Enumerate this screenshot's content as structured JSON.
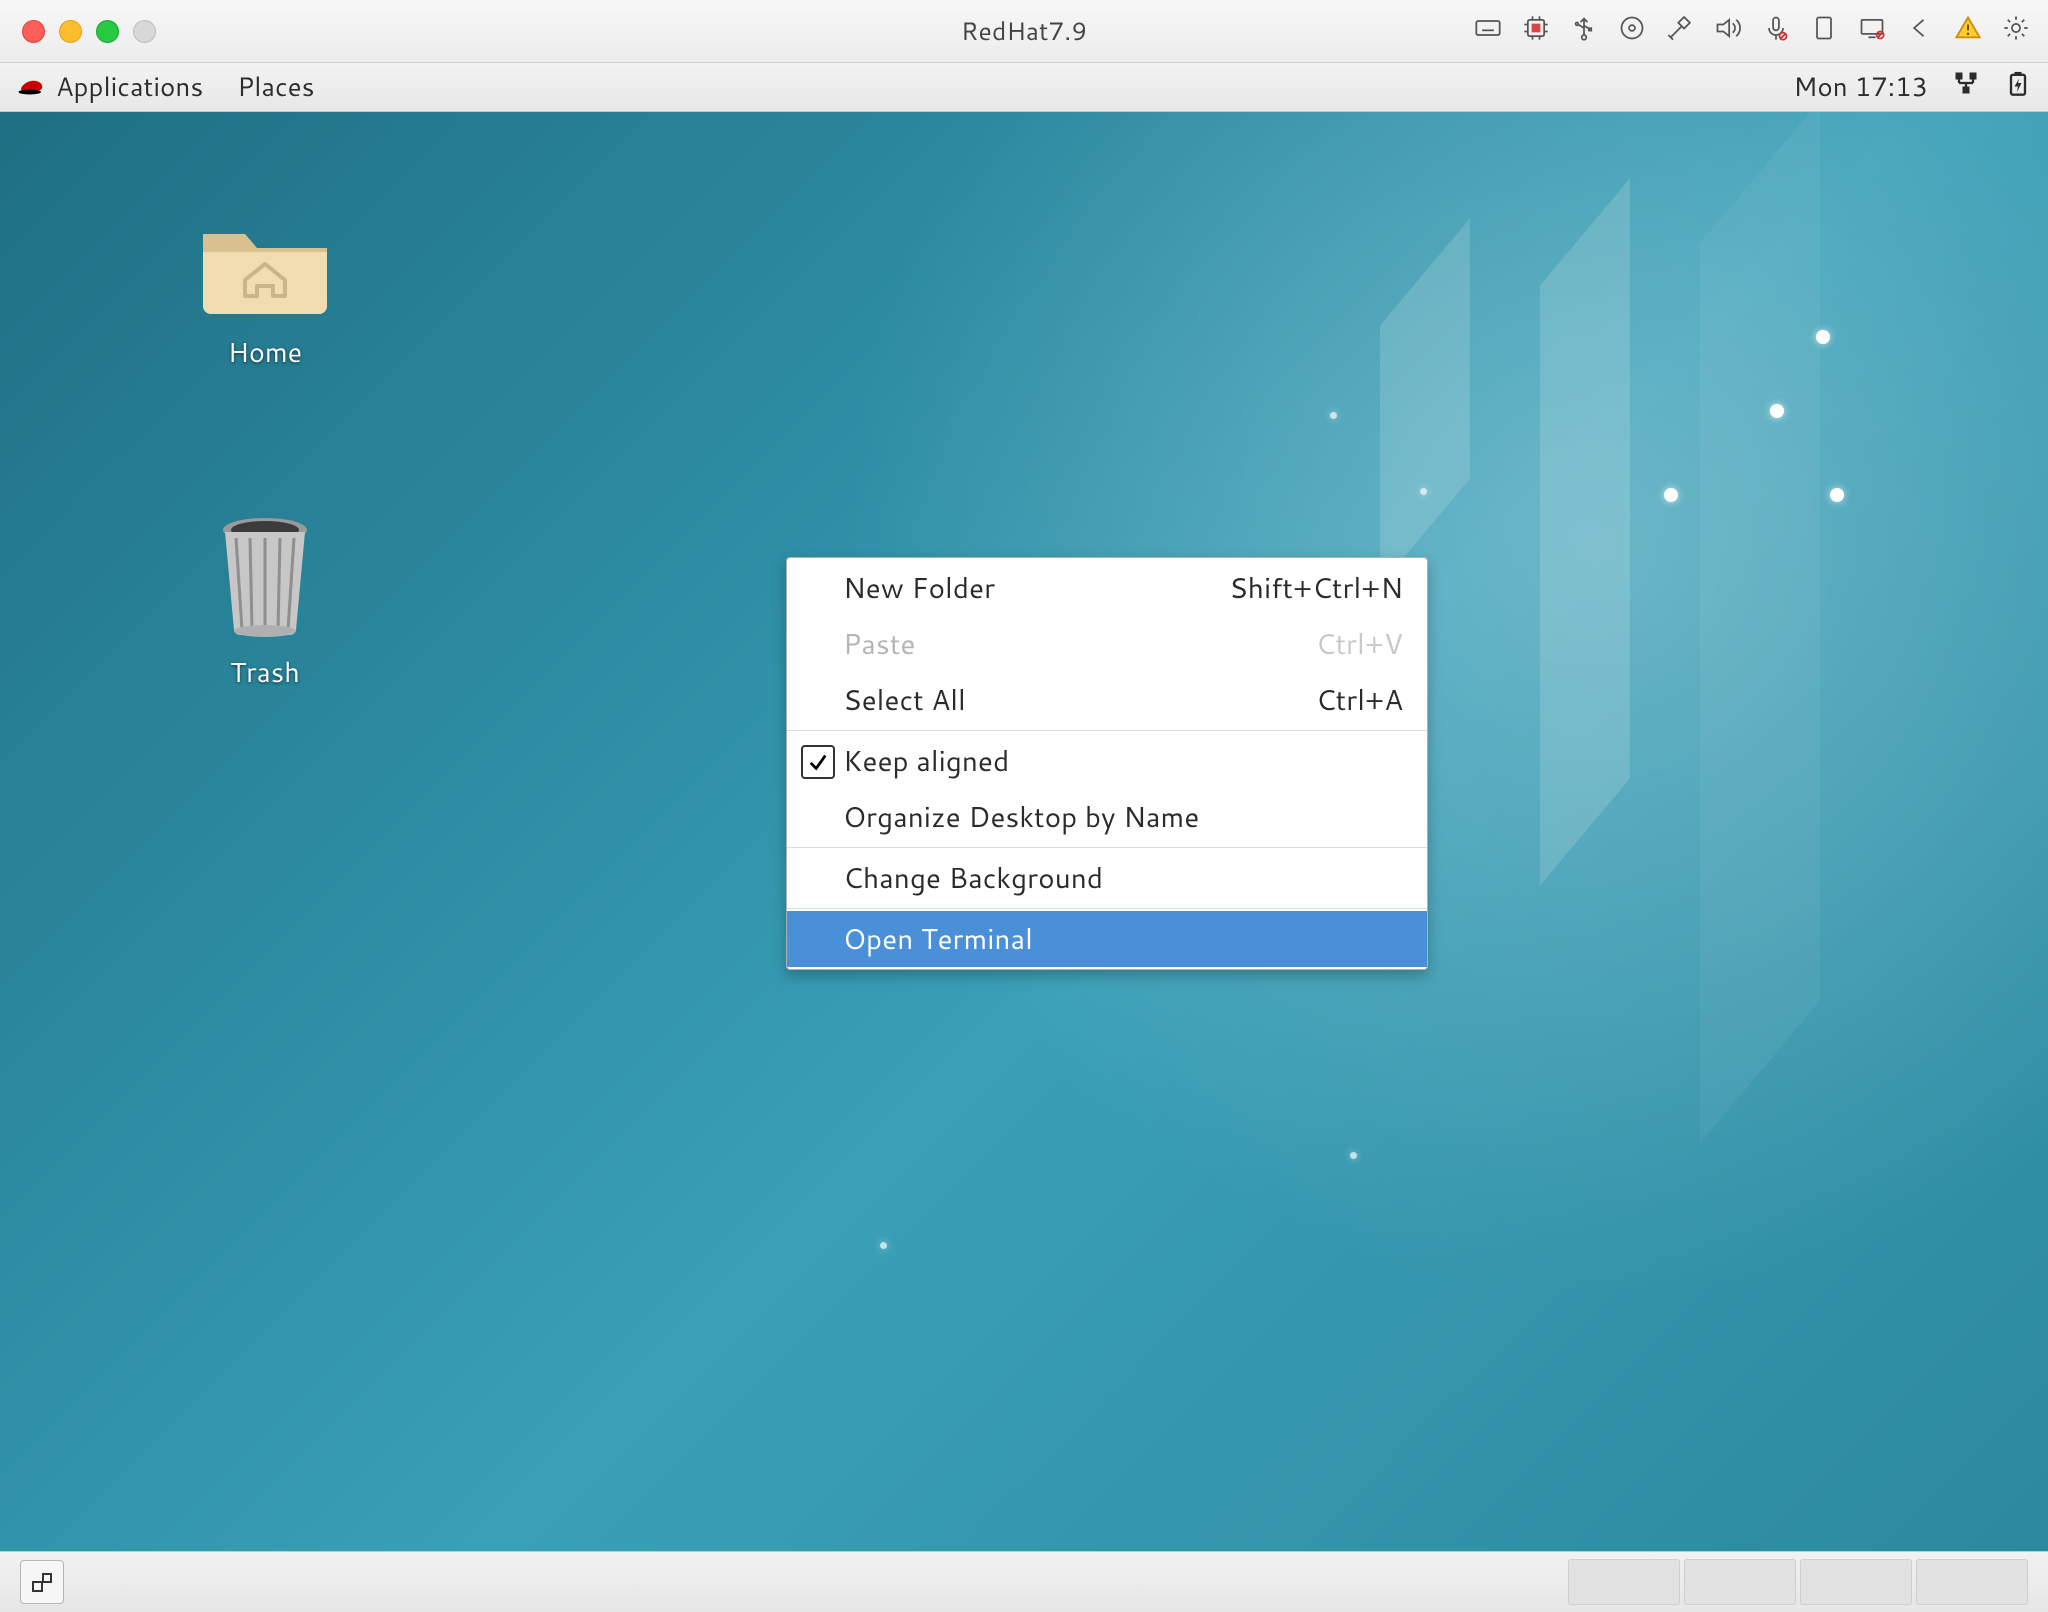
{
  "host": {
    "title": "RedHat7.9",
    "tray_icons": [
      "keyboard-icon",
      "chip-icon",
      "usb-icon",
      "disc-icon",
      "satellite-icon",
      "volume-icon",
      "mic-icon",
      "tablet-icon",
      "display-icon",
      "back-icon",
      "warning-icon",
      "gear-icon"
    ]
  },
  "gnome": {
    "menus": {
      "applications": "Applications",
      "places": "Places"
    },
    "clock": "Mon 17:13"
  },
  "desktop": {
    "icons": {
      "home": "Home",
      "trash": "Trash"
    }
  },
  "context_menu": {
    "items": [
      {
        "label": "New Folder",
        "shortcut": "Shift+Ctrl+N",
        "disabled": false,
        "checkbox": false
      },
      {
        "label": "Paste",
        "shortcut": "Ctrl+V",
        "disabled": true,
        "checkbox": false
      },
      {
        "label": "Select All",
        "shortcut": "Ctrl+A",
        "disabled": false,
        "checkbox": false
      },
      {
        "label": "Keep aligned",
        "shortcut": "",
        "disabled": false,
        "checkbox": true,
        "checked": true
      },
      {
        "label": "Organize Desktop by Name",
        "shortcut": "",
        "disabled": false,
        "checkbox": false
      },
      {
        "label": "Change Background",
        "shortcut": "",
        "disabled": false,
        "checkbox": false
      },
      {
        "label": "Open Terminal",
        "shortcut": "",
        "disabled": false,
        "checkbox": false,
        "highlighted": true
      }
    ],
    "separators_after_index": [
      2,
      4,
      5
    ]
  }
}
